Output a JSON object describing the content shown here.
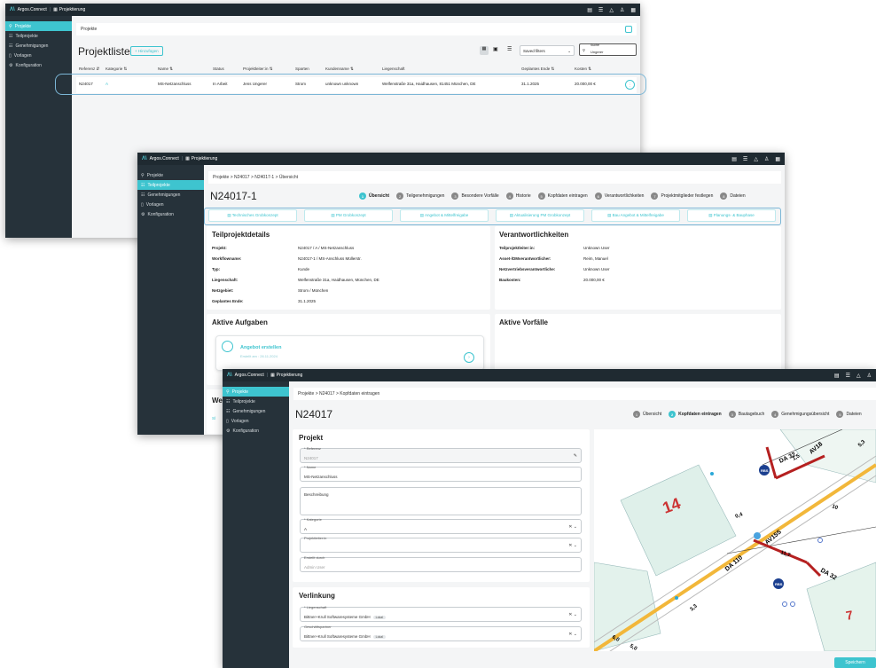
{
  "app": {
    "brand": "Argos.Connect",
    "module": "Projektierung"
  },
  "sidebar": [
    {
      "label": "Projekte",
      "icon": "projects-icon"
    },
    {
      "label": "Teilprojekte",
      "icon": "subprojects-icon"
    },
    {
      "label": "Genehmigungen",
      "icon": "approvals-icon"
    },
    {
      "label": "Vorlagen",
      "icon": "templates-icon"
    },
    {
      "label": "Konfiguration",
      "icon": "config-icon"
    }
  ],
  "list": {
    "crumb": "Projekte",
    "title": "Projektliste",
    "add": "+ Hinzufügen",
    "saved_filters": "Saved filters",
    "search_label": "Suche",
    "search_value": "Ungerer",
    "columns": [
      "Referenz ⇵",
      "Kategorie ⇅",
      "Name ⇅",
      "Status",
      "Projektleiter:in ⇅",
      "Sparten",
      "Kundenname ⇅",
      "Liegenschaft",
      "Geplantes Ende ⇅",
      "Kosten ⇅"
    ],
    "row": [
      "N24017",
      "A",
      "MS-Netzanschluss",
      "In Arbeit",
      "Jens Ungerer",
      "Strom",
      "unknown unknown",
      "Welfenstraße 31a, Haidhausen, 81451 München, DE",
      "31.1.2025",
      "20.000,00 €"
    ]
  },
  "sub": {
    "crumb": "Projekte  >  N24017  >  N24017-1  >  Übersicht",
    "title": "N24017-1",
    "steps": [
      {
        "n": "1",
        "l": "Übersicht"
      },
      {
        "n": "2",
        "l": "Teilgenehmigungen"
      },
      {
        "n": "3",
        "l": "Besondere Vorfälle"
      },
      {
        "n": "4",
        "l": "Historie"
      },
      {
        "n": "5",
        "l": "Kopfdaten eintragen"
      },
      {
        "n": "6",
        "l": "Verantwortlichkeiten"
      },
      {
        "n": "7",
        "l": "Projektmitglieder festlegen"
      },
      {
        "n": "8",
        "l": "Dateien"
      }
    ],
    "tabs": [
      "Technisches Grobkonzept",
      "PM Grobkonzept",
      "Angebot & Mittelfreigabe",
      "Aktualisierung PM Grobkonzept",
      "Bau Angebot & Mittelfreigabe",
      "Planungs- & Bauphase"
    ],
    "details_title": "Teilprojektdetails",
    "details": [
      [
        "Projekt:",
        "N24017 / A / MS-Netzanschluss"
      ],
      [
        "Workflowname:",
        "N24017-1 / MS-Anschluss Müllerstr."
      ],
      [
        "Typ:",
        "Kunde"
      ],
      [
        "Liegenschaft:",
        "Welfenstraße 31a, Haidhausen, München, DE"
      ],
      [
        "Netzgebiet:",
        "Strom / München"
      ],
      [
        "Geplantes Ende:",
        "31.1.2025"
      ]
    ],
    "resp_title": "Verantwortlichkeiten",
    "resp": [
      [
        "Teilprojektleiter:in:",
        "Unknown User"
      ],
      [
        "Asset-/DMverantwortlicher:",
        "Reim, Manuel"
      ],
      [
        "Netzvertriebsverantwortliche:",
        "Unknown User"
      ],
      [
        "Baukosten:",
        "20.000,00 €"
      ]
    ],
    "tasks_title": "Aktive Aufgaben",
    "task_name": "Angebot erstellen",
    "task_date": "Erstellt am : 26.11.2024",
    "incidents_title": "Aktive Vorfälle",
    "we": "We",
    "we2": "Sl"
  },
  "head": {
    "crumb": "Projekte  >  N24017  >  Kopfdaten eintragen",
    "title": "N24017",
    "steps": [
      {
        "n": "1",
        "l": "Übersicht"
      },
      {
        "n": "2",
        "l": "Kopfdaten eintragen"
      },
      {
        "n": "3",
        "l": "Bautagebuch"
      },
      {
        "n": "4",
        "l": "Genehmigungsübersicht"
      },
      {
        "n": "5",
        "l": "Dateien"
      }
    ],
    "projekt_title": "Projekt",
    "referenz_label": "* Referenz",
    "referenz_value": "N24017",
    "name_label": "* Name",
    "name_value": "MS-Netzanschluss",
    "beschreibung_label": "Beschreibung",
    "kategorie_label": "* Kategorie",
    "kategorie_value": "A",
    "pl_label": "Projektleiter:in",
    "ersteller_label": "Erstellt durch",
    "ersteller_value": "Admin User",
    "verlinkung_title": "Verlinkung",
    "lieg_label": "* Liegenschaft",
    "lieg_value": "Bittner+Krull Softwaresysteme GmbH",
    "gp_label": "Geschäftspartner",
    "gp_value": "Bittner+Krull Softwaresysteme GmbH",
    "chip": "Lokal",
    "save": "Speichern",
    "map_labels": [
      "14",
      "7",
      "DA 32",
      "AV18",
      "AV15S",
      "DA 110",
      "DA 32",
      "11,7",
      "10",
      "6,0",
      "5,0",
      "5,3",
      "3,3",
      "0,4",
      "1,5",
      "RBS",
      "RBS"
    ]
  }
}
